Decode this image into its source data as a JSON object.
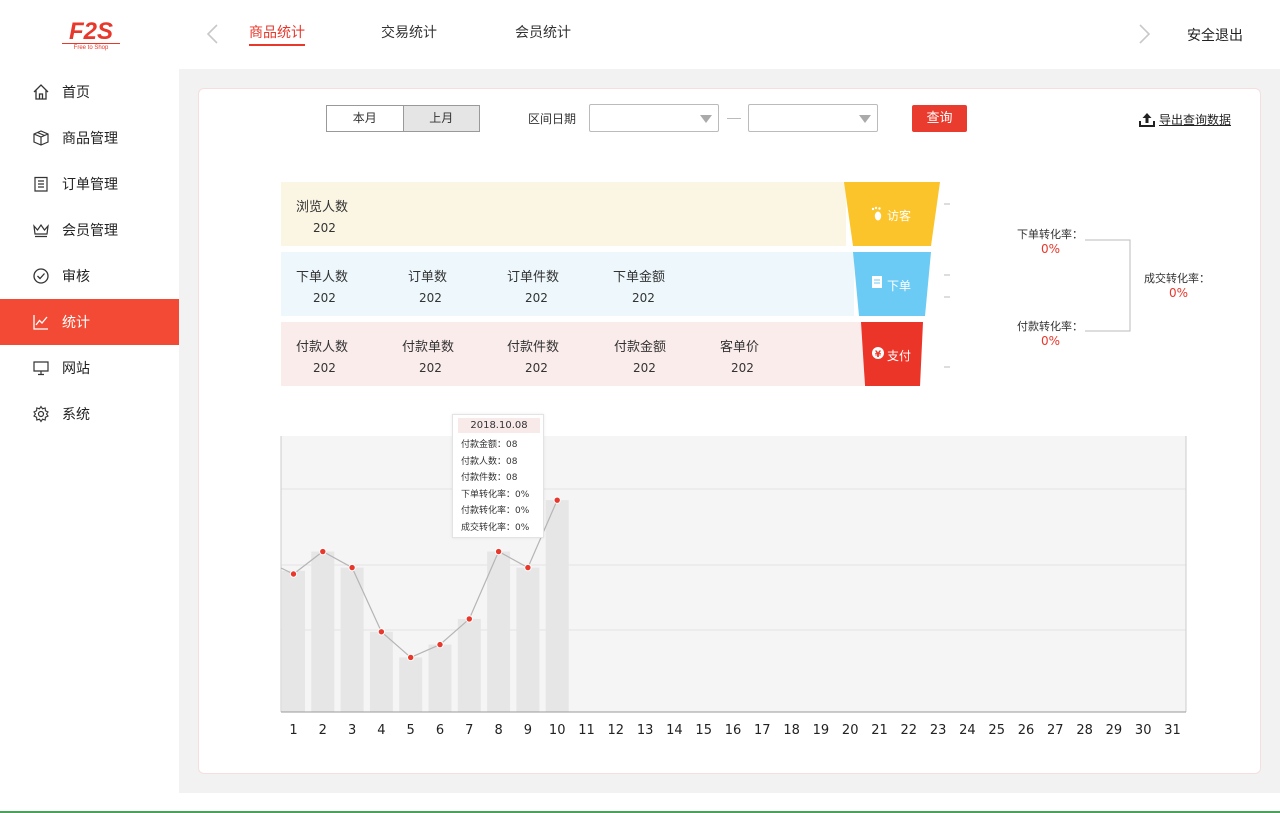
{
  "logo": {
    "main": "F2S",
    "sub": "Free to Shop"
  },
  "header": {
    "tabs": [
      {
        "label": "商品统计",
        "active": true
      },
      {
        "label": "交易统计",
        "active": false
      },
      {
        "label": "会员统计",
        "active": false
      }
    ],
    "logout": "安全退出"
  },
  "sidebar": {
    "items": [
      {
        "label": "首页",
        "icon": "home-icon"
      },
      {
        "label": "商品管理",
        "icon": "box-icon"
      },
      {
        "label": "订单管理",
        "icon": "clipboard-icon"
      },
      {
        "label": "会员管理",
        "icon": "crown-icon"
      },
      {
        "label": "审核",
        "icon": "check-circle-icon"
      },
      {
        "label": "统计",
        "icon": "chart-line-icon",
        "active": true
      },
      {
        "label": "网站",
        "icon": "monitor-icon"
      },
      {
        "label": "系统",
        "icon": "gear-icon"
      }
    ]
  },
  "filters": {
    "this_month": "本月",
    "last_month": "上月",
    "selected": "上月",
    "range_label": "区间日期",
    "start_date": "",
    "end_date": "",
    "query": "查询",
    "export": "导出查询数据"
  },
  "stats": {
    "browse": {
      "funnel": "访客",
      "items": [
        {
          "title": "浏览人数",
          "value": "202"
        }
      ]
    },
    "order": {
      "funnel": "下单",
      "items": [
        {
          "title": "下单人数",
          "value": "202"
        },
        {
          "title": "订单数",
          "value": "202"
        },
        {
          "title": "订单件数",
          "value": "202"
        },
        {
          "title": "下单金额",
          "value": "202"
        }
      ]
    },
    "pay": {
      "funnel": "支付",
      "items": [
        {
          "title": "付款人数",
          "value": "202"
        },
        {
          "title": "付款单数",
          "value": "202"
        },
        {
          "title": "付款件数",
          "value": "202"
        },
        {
          "title": "付款金额",
          "value": "202"
        },
        {
          "title": "客单价",
          "value": "202"
        }
      ]
    }
  },
  "rates": {
    "order_rate_label": "下单转化率：",
    "order_rate": "0%",
    "pay_rate_label": "付款转化率：",
    "pay_rate": "0%",
    "deal_rate_label": "成交转化率：",
    "deal_rate": "0%"
  },
  "colors": {
    "accent": "#f24a35",
    "browse_bg": "#fbf5e3",
    "order_bg": "#edf7fc",
    "pay_bg": "#fbecec",
    "funnel_browse": "#fbc42a",
    "funnel_order": "#6ccbf5",
    "funnel_pay": "#ec3529",
    "bar": "#e6e6e6",
    "line": "#b5b5b5",
    "point": "#e8372b"
  },
  "chart_data": {
    "type": "bar",
    "x": [
      1,
      2,
      3,
      4,
      5,
      6,
      7,
      8,
      9,
      10,
      11,
      12,
      13,
      14,
      15,
      16,
      17,
      18,
      19,
      20,
      21,
      22,
      23,
      24,
      25,
      26,
      27,
      28,
      29,
      30,
      31
    ],
    "categories": [
      "1",
      "2",
      "3",
      "4",
      "5",
      "6",
      "7",
      "8",
      "9",
      "10",
      "11",
      "12",
      "13",
      "14",
      "15",
      "16",
      "17",
      "18",
      "19",
      "20",
      "21",
      "22",
      "23",
      "24",
      "25",
      "26",
      "27",
      "28",
      "29",
      "30",
      "31"
    ],
    "series": [
      {
        "type": "bar",
        "values": [
          44,
          50,
          45,
          25,
          17,
          21,
          29,
          50,
          45,
          66
        ]
      },
      {
        "type": "line",
        "values": [
          43,
          50,
          45,
          25,
          17,
          21,
          29,
          50,
          45,
          66
        ]
      }
    ],
    "ylim": [
      0,
      86
    ],
    "grid": true,
    "tooltip": {
      "date": "2018.10.08",
      "rows": [
        "付款金额：08",
        "付款人数：08",
        "付款件数：08",
        "下单转化率：0%",
        "付款转化率：0%",
        "成交转化率：0%"
      ]
    }
  }
}
